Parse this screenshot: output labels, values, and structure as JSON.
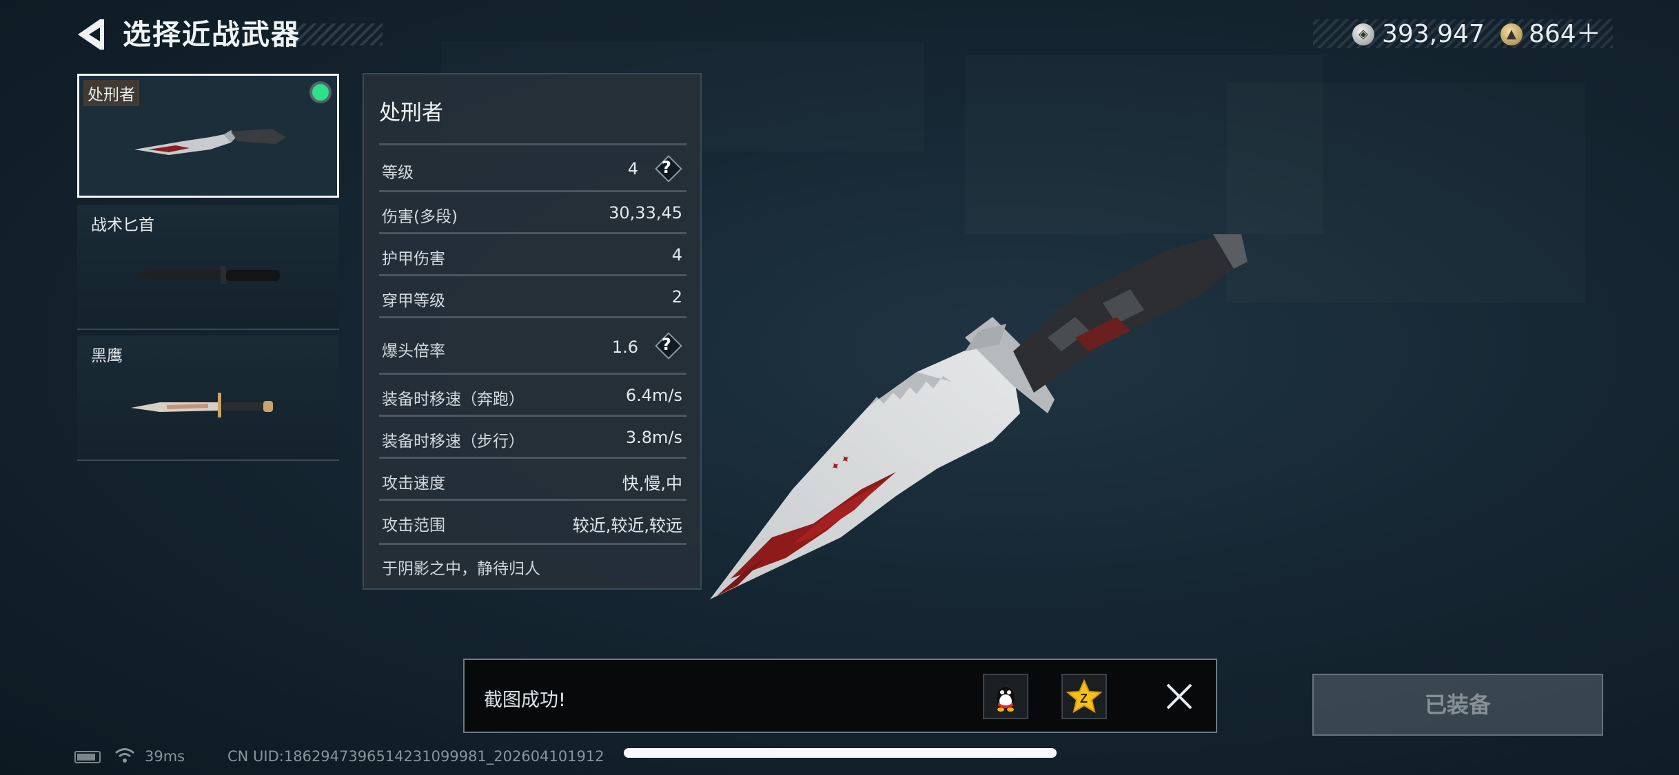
{
  "header": {
    "title": "选择近战武器",
    "back_icon": "back-arrow-icon",
    "currency": [
      {
        "icon": "silver-coin-icon",
        "value": "393,947",
        "color": "#cfd2d4"
      },
      {
        "icon": "gold-coin-icon",
        "value": "864＋",
        "color": "#c7a95c"
      }
    ]
  },
  "weapons": [
    {
      "name": "处刑者",
      "selected": true,
      "icon": "executioner-knife-icon"
    },
    {
      "name": "战术匕首",
      "selected": false,
      "icon": "tactical-dagger-icon"
    },
    {
      "name": "黑鹰",
      "selected": false,
      "icon": "black-hawk-knife-icon"
    }
  ],
  "details": {
    "name": "处刑者",
    "stats": [
      {
        "label": "等级",
        "value": "4",
        "help": true
      },
      {
        "label": "伤害(多段)",
        "value": "30,33,45",
        "help": false
      },
      {
        "label": "护甲伤害",
        "value": "4",
        "help": false
      },
      {
        "label": "穿甲等级",
        "value": "2",
        "help": false
      },
      {
        "label": "爆头倍率",
        "value": "1.6",
        "help": true
      },
      {
        "label": "装备时移速（奔跑）",
        "value": "6.4m/s",
        "help": false
      },
      {
        "label": "装备时移速（步行）",
        "value": "3.8m/s",
        "help": false
      },
      {
        "label": "攻击速度",
        "value": "快,慢,中",
        "help": false
      },
      {
        "label": "攻击范围",
        "value": "较近,较近,较远",
        "help": false
      }
    ],
    "flavor": "于阴影之中，静待归人"
  },
  "toast": {
    "message": "截图成功!",
    "share_qq_icon": "qq-penguin-icon",
    "share_qzone_icon": "qzone-star-icon",
    "close_icon": "close-icon"
  },
  "equip_button": {
    "label": "已装备",
    "enabled": false
  },
  "footer": {
    "ping": "39ms",
    "uid": "CN UID:1862947396514231099981_202604101912"
  },
  "colors": {
    "accent_selected": "#2fe08a",
    "panel": "#263038"
  }
}
